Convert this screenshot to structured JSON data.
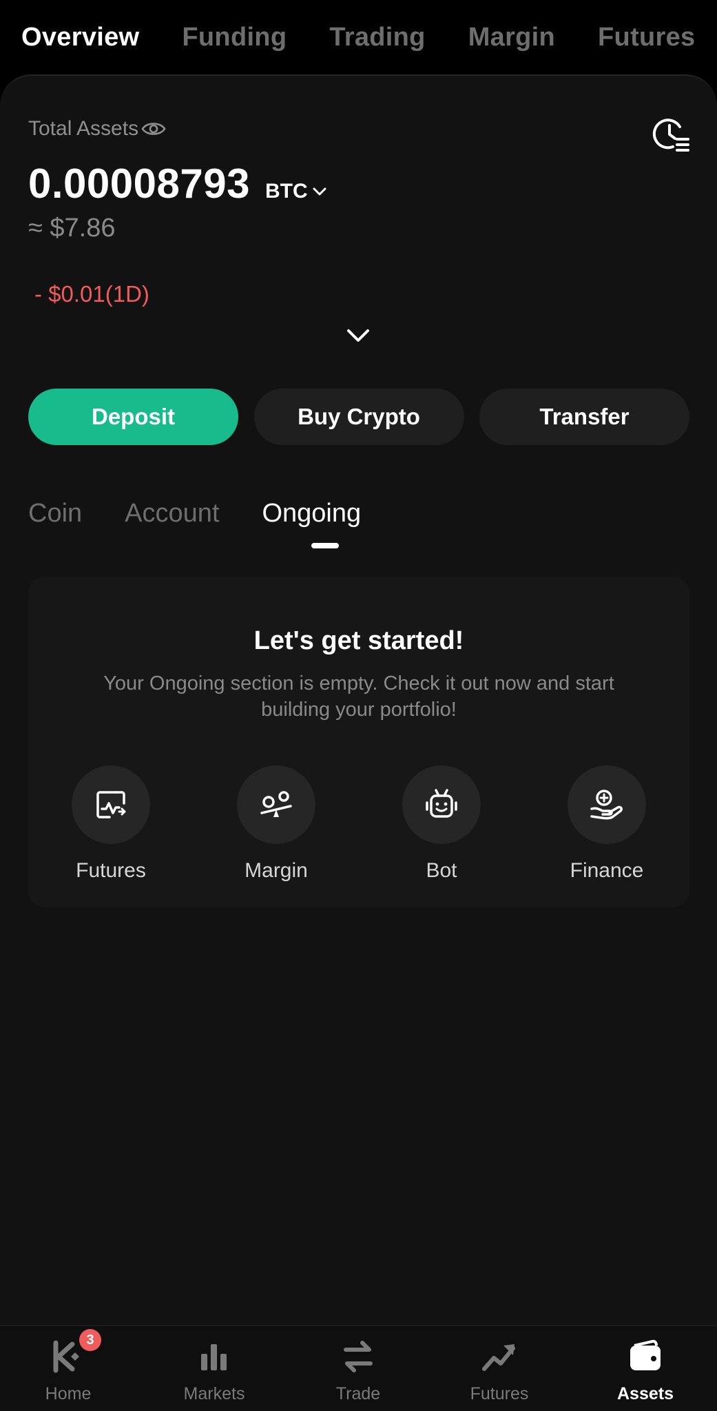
{
  "top_tabs": [
    {
      "label": "Overview",
      "active": true
    },
    {
      "label": "Funding",
      "active": false
    },
    {
      "label": "Trading",
      "active": false
    },
    {
      "label": "Margin",
      "active": false
    },
    {
      "label": "Futures",
      "active": false
    }
  ],
  "summary": {
    "label": "Total Assets",
    "balance": "0.00008793",
    "unit": "BTC",
    "approx_usd": "≈ $7.86",
    "pnl": "- $0.01(1D)"
  },
  "actions": {
    "deposit": "Deposit",
    "buy_crypto": "Buy Crypto",
    "transfer": "Transfer"
  },
  "sub_tabs": [
    {
      "label": "Coin",
      "active": false
    },
    {
      "label": "Account",
      "active": false
    },
    {
      "label": "Ongoing",
      "active": true
    }
  ],
  "empty_state": {
    "title": "Let's get started!",
    "message": "Your Ongoing section is empty. Check it out now and start building your portfolio!",
    "shortcuts": [
      {
        "label": "Futures",
        "icon": "futures-chart-icon"
      },
      {
        "label": "Margin",
        "icon": "margin-icon"
      },
      {
        "label": "Bot",
        "icon": "bot-icon"
      },
      {
        "label": "Finance",
        "icon": "finance-icon"
      }
    ]
  },
  "bottom_nav": {
    "items": [
      {
        "label": "Home",
        "icon": "home-logo-icon",
        "badge": "3",
        "active": false
      },
      {
        "label": "Markets",
        "icon": "bar-chart-icon",
        "active": false
      },
      {
        "label": "Trade",
        "icon": "swap-arrows-icon",
        "active": false
      },
      {
        "label": "Futures",
        "icon": "trend-up-icon",
        "active": false
      },
      {
        "label": "Assets",
        "icon": "wallet-icon",
        "active": true
      }
    ]
  },
  "colors": {
    "accent": "#18bc8c",
    "negative": "#f05b5b",
    "background": "#121212"
  }
}
